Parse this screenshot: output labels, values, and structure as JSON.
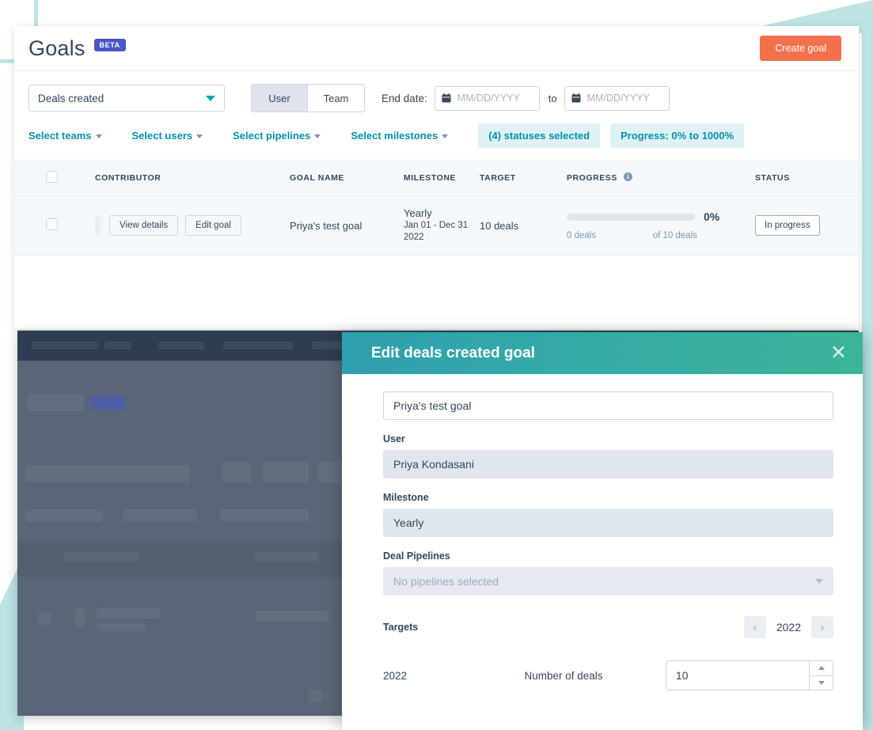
{
  "page": {
    "title": "Goals",
    "beta_badge": "BETA",
    "create_goal_label": "Create goal"
  },
  "filters": {
    "metric_select": {
      "value": "Deals created",
      "caret_icon": "chevron-down-icon"
    },
    "scope_toggle": {
      "options": [
        "User",
        "Team"
      ],
      "selected": "User"
    },
    "end_date": {
      "label": "End date:",
      "from_placeholder": "MM/DD/YYYY",
      "to_label": "to",
      "to_placeholder": "MM/DD/YYYY",
      "calendar_icon": "calendar-icon"
    },
    "links": [
      {
        "label": "Select teams",
        "name": "select-teams"
      },
      {
        "label": "Select users",
        "name": "select-users"
      },
      {
        "label": "Select pipelines",
        "name": "select-pipelines"
      },
      {
        "label": "Select milestones",
        "name": "select-milestones"
      }
    ],
    "chips": [
      {
        "label": "(4) statuses selected",
        "name": "statuses-selected",
        "caret": true
      },
      {
        "label": "Progress: 0% to 1000%",
        "name": "progress-range",
        "caret": false
      }
    ]
  },
  "table": {
    "columns": [
      "CONTRIBUTOR",
      "GOAL NAME",
      "MILESTONE",
      "TARGET",
      "PROGRESS",
      "STATUS"
    ],
    "progress_info_icon": "info-icon",
    "rows": [
      {
        "view_details_label": "View details",
        "edit_goal_label": "Edit goal",
        "goal_name": "Priya's test goal",
        "milestone_name": "Yearly",
        "milestone_range": "Jan 01 - Dec 31",
        "milestone_year": "2022",
        "target": "10 deals",
        "progress_percent": "0%",
        "progress_value": 0,
        "progress_current": "0 deals",
        "progress_total": "of 10 deals",
        "status": "In progress"
      }
    ]
  },
  "modal": {
    "title": "Edit deals created goal",
    "close_icon": "close-icon",
    "goal_name": {
      "value": "Priya's test goal"
    },
    "user": {
      "label": "User",
      "value": "Priya Kondasani"
    },
    "milestone": {
      "label": "Milestone",
      "value": "Yearly"
    },
    "deal_pipelines": {
      "label": "Deal Pipelines",
      "placeholder": "No pipelines selected"
    },
    "targets": {
      "label": "Targets",
      "year": "2022",
      "prev_icon": "chevron-left-icon",
      "next_icon": "chevron-right-icon",
      "rows": [
        {
          "year": "2022",
          "label": "Number of deals",
          "value": "10"
        }
      ]
    }
  },
  "colors": {
    "brand_orange": "#f2714d",
    "beta_purple": "#4a55c9",
    "link_teal": "#0091ae",
    "chip_bg": "#dff1f4",
    "modal_gradient_start": "#2e9fb0",
    "modal_gradient_end": "#3cb49a",
    "deco_teal": "#bde3e3",
    "navy": "#33475b"
  }
}
